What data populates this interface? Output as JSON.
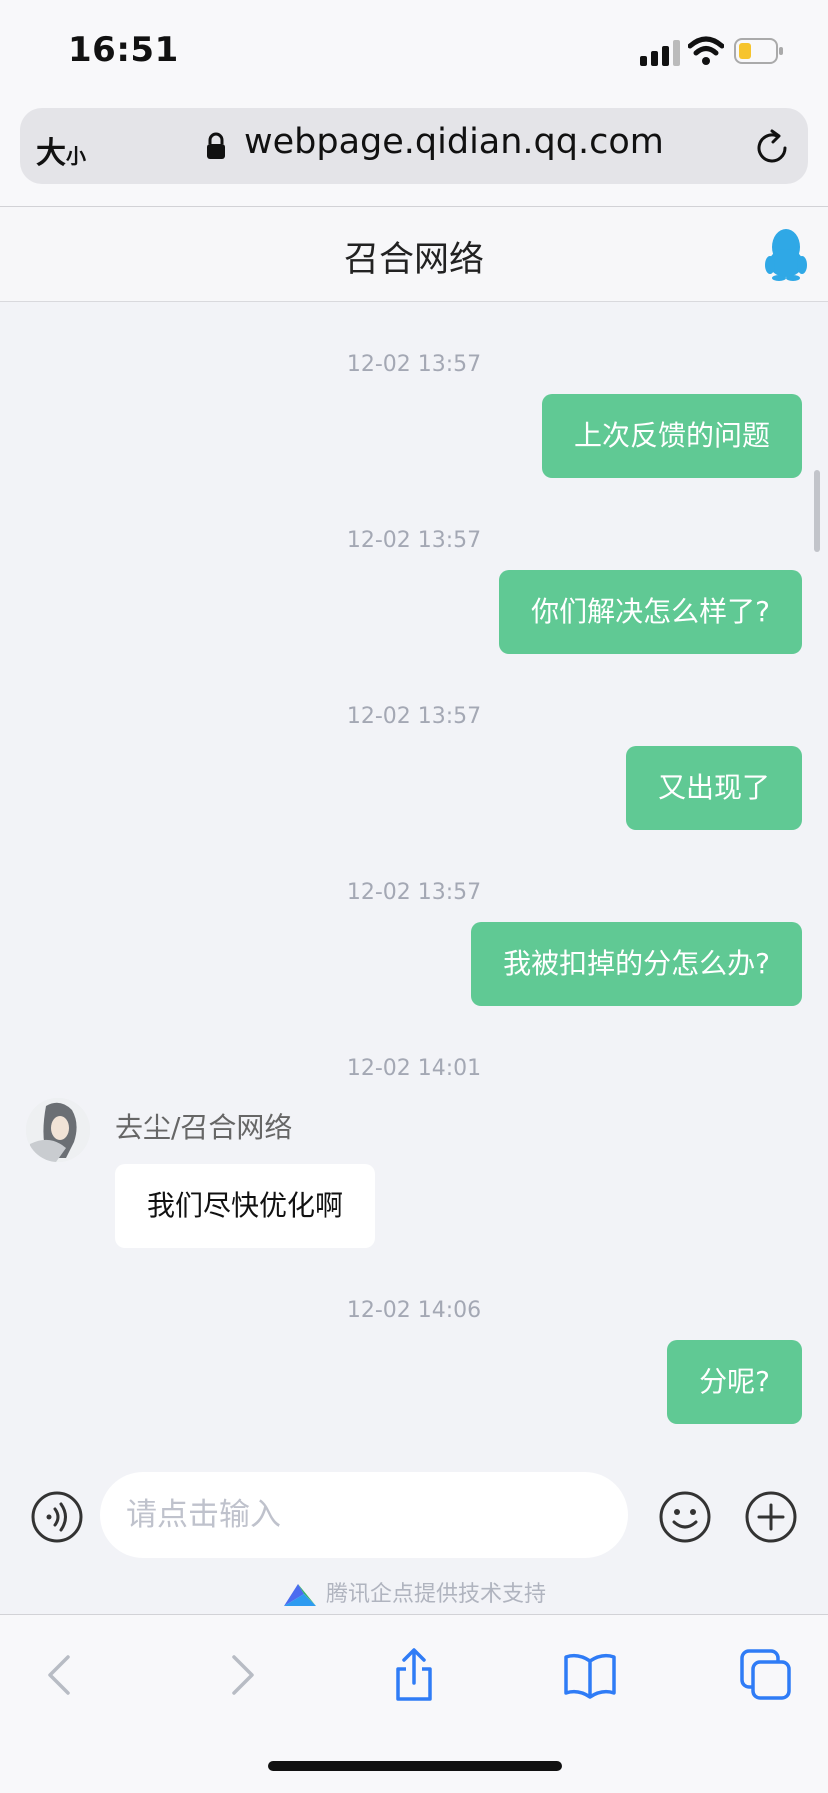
{
  "status_bar": {
    "time": "16:51"
  },
  "address_bar": {
    "text_size_big": "大",
    "text_size_small": "小",
    "url": "webpage.qidian.qq.com"
  },
  "header": {
    "title": "召合网络"
  },
  "messages": [
    {
      "timestamp": "12-02 13:57",
      "side": "right",
      "text": "上次反馈的问题"
    },
    {
      "timestamp": "12-02 13:57",
      "side": "right",
      "text": "你们解决怎么样了?"
    },
    {
      "timestamp": "12-02 13:57",
      "side": "right",
      "text": "又出现了"
    },
    {
      "timestamp": "12-02 13:57",
      "side": "right",
      "text": "我被扣掉的分怎么办?"
    },
    {
      "timestamp": "12-02 14:01",
      "side": "left",
      "sender": "去尘/召合网络",
      "text": "我们尽快优化啊"
    },
    {
      "timestamp": "12-02 14:06",
      "side": "right",
      "text": "分呢?"
    }
  ],
  "input": {
    "placeholder": "请点击输入"
  },
  "footer": {
    "powered_by": "腾讯企点提供技术支持"
  },
  "colors": {
    "sent_bubble": "#60c994",
    "received_bubble": "#ffffff",
    "accent_blue": "#2f7cf6"
  }
}
